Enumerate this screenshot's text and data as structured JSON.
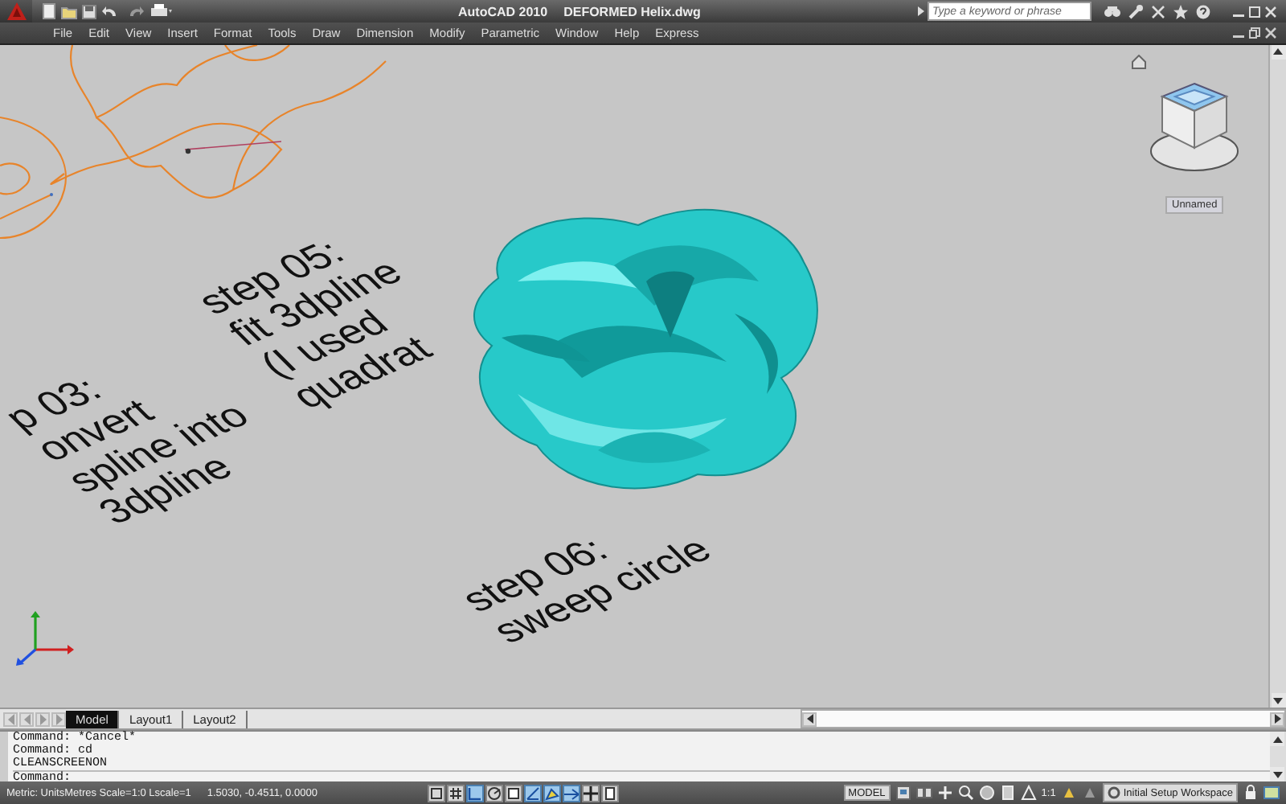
{
  "title_bar": {
    "app_name": "AutoCAD 2010",
    "document": "DEFORMED Helix.dwg",
    "search": {
      "placeholder": "Type a keyword or phrase"
    }
  },
  "menu": [
    "File",
    "Edit",
    "View",
    "Insert",
    "Format",
    "Tools",
    "Draw",
    "Dimension",
    "Modify",
    "Parametric",
    "Window",
    "Help",
    "Express"
  ],
  "viewport": {
    "notes": [
      {
        "lines": [
          "step 05:",
          "fit 3dpline",
          "(I used",
          "quadrat"
        ]
      },
      {
        "lines": [
          "p 03:",
          "onvert",
          "spline into",
          "3dpline"
        ]
      },
      {
        "lines": [
          "step 06:",
          "sweep circle"
        ]
      }
    ],
    "view_menu": "Unnamed"
  },
  "layout_tabs": [
    {
      "label": "Model",
      "selected": true
    },
    {
      "label": "Layout1",
      "selected": false
    },
    {
      "label": "Layout2",
      "selected": false
    }
  ],
  "command": {
    "history": [
      "Command: *Cancel*",
      "Command: cd",
      "CLEANSCREENON"
    ],
    "prompt": "Command:"
  },
  "status_bar": {
    "units": "Metric: UnitsMetres Scale=1:0 Lscale=1",
    "coordinates": "1.5030, -0.4511, 0.0000",
    "toggles": [
      {
        "kind": "snap",
        "on": false
      },
      {
        "kind": "grid",
        "on": false
      },
      {
        "kind": "ortho",
        "on": true
      },
      {
        "kind": "polar",
        "on": false
      },
      {
        "kind": "osnap",
        "on": false
      },
      {
        "kind": "otrack",
        "on": true
      },
      {
        "kind": "ducs",
        "on": true
      },
      {
        "kind": "dyn",
        "on": true
      },
      {
        "kind": "lwt",
        "on": false
      },
      {
        "kind": "qp",
        "on": false
      }
    ],
    "space": "MODEL",
    "annotation_scale": "1:1",
    "workspace": "Initial Setup Workspace"
  }
}
